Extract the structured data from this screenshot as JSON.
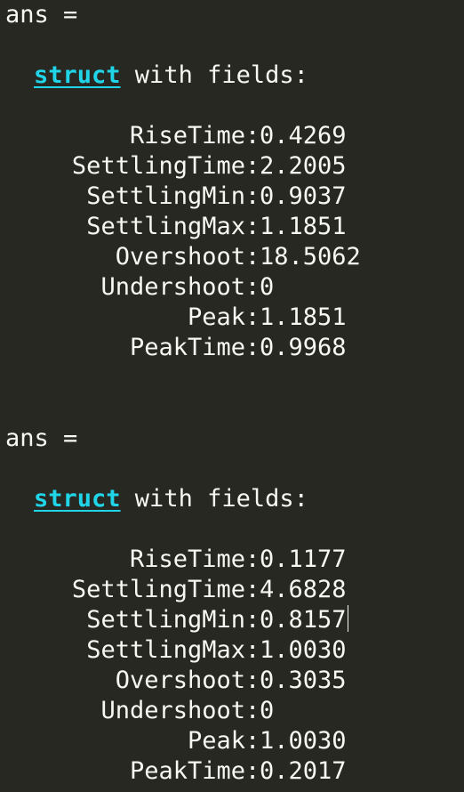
{
  "outputs": [
    {
      "ans_label": "ans =",
      "struct_keyword": "struct",
      "with_fields": " with fields:",
      "fields": [
        {
          "name": "RiseTime",
          "value": "0.4269"
        },
        {
          "name": "SettlingTime",
          "value": "2.2005"
        },
        {
          "name": "SettlingMin",
          "value": "0.9037"
        },
        {
          "name": "SettlingMax",
          "value": "1.1851"
        },
        {
          "name": "Overshoot",
          "value": "18.5062"
        },
        {
          "name": "Undershoot",
          "value": "0"
        },
        {
          "name": "Peak",
          "value": "1.1851"
        },
        {
          "name": "PeakTime",
          "value": "0.9968"
        }
      ]
    },
    {
      "ans_label": "ans =",
      "struct_keyword": "struct",
      "with_fields": " with fields:",
      "fields": [
        {
          "name": "RiseTime",
          "value": "0.1177"
        },
        {
          "name": "SettlingTime",
          "value": "4.6828"
        },
        {
          "name": "SettlingMin",
          "value": "0.8157"
        },
        {
          "name": "SettlingMax",
          "value": "1.0030"
        },
        {
          "name": "Overshoot",
          "value": "0.3035"
        },
        {
          "name": "Undershoot",
          "value": "0"
        },
        {
          "name": "Peak",
          "value": "1.0030"
        },
        {
          "name": "PeakTime",
          "value": "0.2017"
        }
      ]
    }
  ],
  "colors": {
    "background": "#272822",
    "text": "#f8f8f2",
    "keyword": "#20d5e8"
  }
}
